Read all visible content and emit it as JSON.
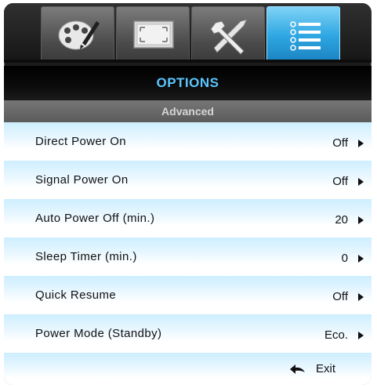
{
  "tabs": [
    {
      "icon": "palette-icon",
      "active": false
    },
    {
      "icon": "display-icon",
      "active": false
    },
    {
      "icon": "tools-icon",
      "active": false
    },
    {
      "icon": "options-list-icon",
      "active": true
    }
  ],
  "header": {
    "title": "OPTIONS",
    "subtitle": "Advanced"
  },
  "menu": {
    "items": [
      {
        "label": "Direct Power On",
        "value": "Off"
      },
      {
        "label": "Signal Power On",
        "value": "Off"
      },
      {
        "label": "Auto Power Off (min.)",
        "value": "20"
      },
      {
        "label": "Sleep Timer (min.)",
        "value": "0"
      },
      {
        "label": "Quick Resume",
        "value": "Off"
      },
      {
        "label": "Power Mode (Standby)",
        "value": "Eco."
      }
    ],
    "exit_label": "Exit"
  },
  "colors": {
    "accent": "#5cc6ff",
    "active_tab": "#2ea7e2",
    "row_tint": "#cdeeff"
  }
}
